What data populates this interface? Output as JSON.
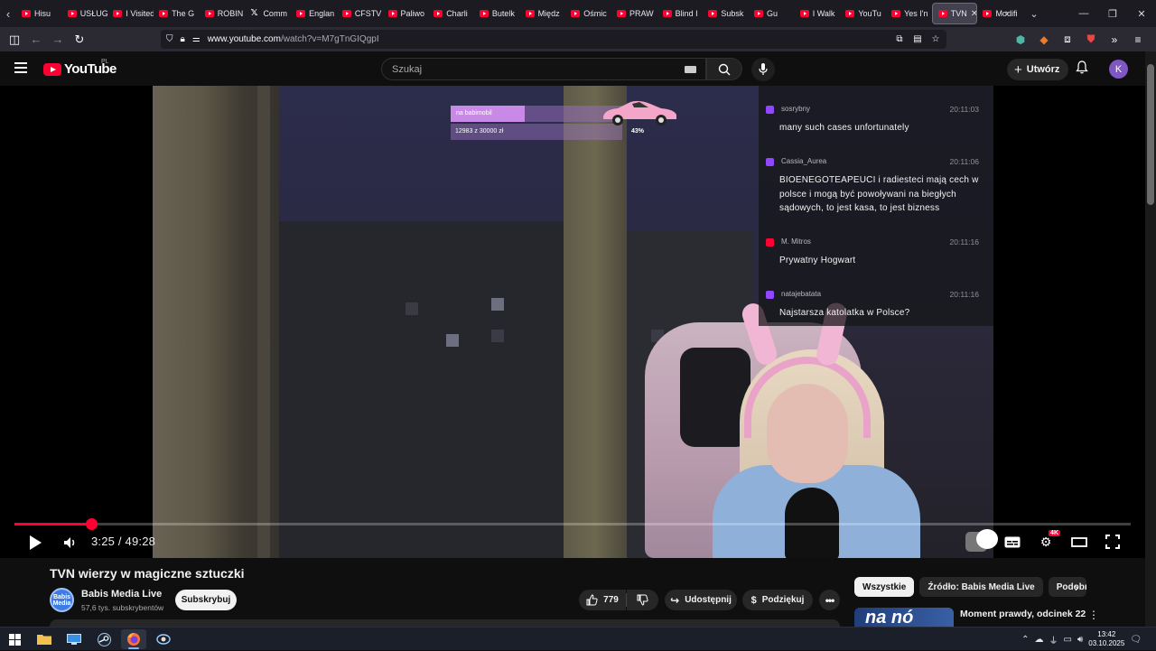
{
  "browser": {
    "tabs": [
      {
        "title": "Hisu",
        "favicon": "youtube"
      },
      {
        "title": "USŁUGI",
        "favicon": "youtube"
      },
      {
        "title": "I Visited",
        "favicon": "youtube"
      },
      {
        "title": "The G",
        "favicon": "youtube"
      },
      {
        "title": "ROBIN",
        "favicon": "youtube"
      },
      {
        "title": "Comm",
        "favicon": "x"
      },
      {
        "title": "Englan",
        "favicon": "youtube"
      },
      {
        "title": "CFSTV",
        "favicon": "youtube"
      },
      {
        "title": "Paliwo",
        "favicon": "youtube"
      },
      {
        "title": "Charli",
        "favicon": "youtube"
      },
      {
        "title": "Butelk",
        "favicon": "youtube"
      },
      {
        "title": "Międz",
        "favicon": "youtube"
      },
      {
        "title": "Ośmic",
        "favicon": "youtube"
      },
      {
        "title": "PRAW",
        "favicon": "youtube"
      },
      {
        "title": "Blind I",
        "favicon": "youtube"
      },
      {
        "title": "Subsk",
        "favicon": "youtube"
      },
      {
        "title": "Gu",
        "favicon": "youtube"
      },
      {
        "title": "I Walk",
        "favicon": "youtube"
      },
      {
        "title": "YouTu",
        "favicon": "youtube"
      },
      {
        "title": "Yes I'n",
        "favicon": "youtube"
      },
      {
        "title": "TVN",
        "favicon": "youtube",
        "active": true
      },
      {
        "title": "Modifi",
        "favicon": "youtube"
      }
    ],
    "url_host": "www.youtube.com",
    "url_path": "/watch?v=M7gTnGIQgpI"
  },
  "youtube": {
    "logo_text": "YouTube",
    "region": "PL",
    "search_placeholder": "Szukaj",
    "create_label": "Utwórz",
    "avatar_letter": "K"
  },
  "overlay": {
    "goal_label": "na babimobil",
    "goal_amount": "12983  z  30000  zł",
    "goal_percent_text": "43%",
    "goal_fraction": 0.43
  },
  "chat": [
    {
      "source": "twitch",
      "user": "sosrybny",
      "time": "20:11:03",
      "text": "many such cases unfortunately"
    },
    {
      "source": "twitch",
      "user": "Cassia_Aurea",
      "time": "20:11:06",
      "text": "BIOENEGOTEAPEUCI i radiesteci mają cech w polsce i mogą być powoływani na biegłych sądowych, to jest kasa, to jest bizness"
    },
    {
      "source": "youtube",
      "user": "M. Mitros",
      "time": "20:11:16",
      "text": "Prywatny Hogwart"
    },
    {
      "source": "twitch",
      "user": "natajebatata",
      "time": "20:11:16",
      "text": "Najstarsza katolatka w Polsce?"
    }
  ],
  "player": {
    "current_time": "3:25",
    "duration": "49:28",
    "time_display": "3:25 / 49:28",
    "progress_fraction": 0.069,
    "quality_badge": "4K"
  },
  "video": {
    "title": "TVN wierzy w magiczne sztuczki",
    "channel_name": "Babis Media Live",
    "channel_avatar_text": "Babis Media",
    "subscribers": "57,6 tys. subskrybentów",
    "subscribe_label": "Subskrybuj",
    "likes": "779",
    "share_label": "Udostępnij",
    "thanks_label": "Podziękuj"
  },
  "recommendations": {
    "chips": [
      "Wszystkie",
      "Źródło: Babis Media Live",
      "Podobne"
    ],
    "first_title": "Moment prawdy, odcinek 22",
    "first_thumb_text": "na nó"
  },
  "taskbar": {
    "time": "13:42",
    "date": "03.10.2025"
  },
  "colors": {
    "youtube_red": "#ff0033",
    "twitch_purple": "#9146ff",
    "overlay_pink": "#c989e6"
  }
}
